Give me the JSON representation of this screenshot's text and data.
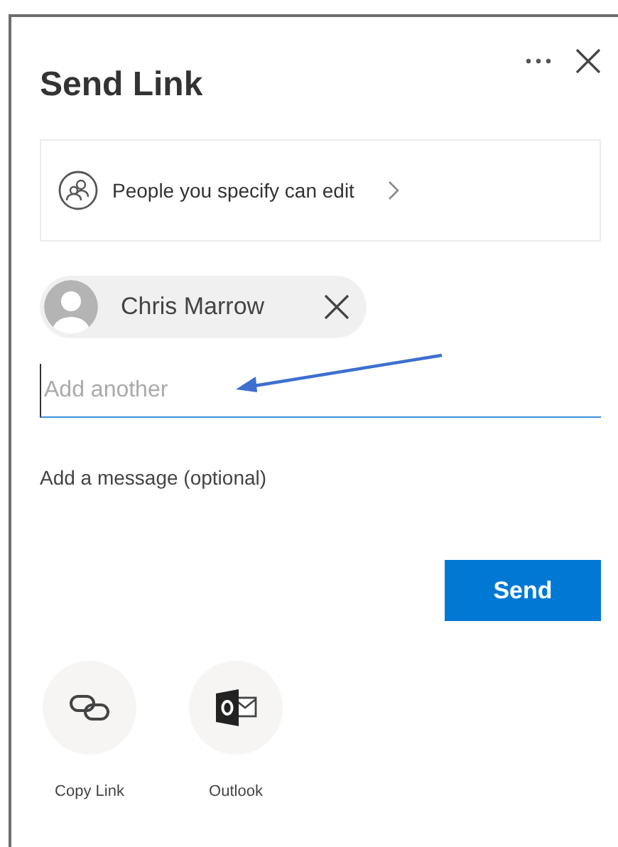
{
  "dialog": {
    "title": "Send Link"
  },
  "permission": {
    "label": "People you specify can edit"
  },
  "recipients": [
    {
      "name": "Chris Marrow"
    }
  ],
  "recipient_input": {
    "placeholder": "Add another",
    "focused": true
  },
  "message": {
    "placeholder": "Add a message (optional)"
  },
  "send_button": {
    "label": "Send"
  },
  "share_options": [
    {
      "kind": "copy-link",
      "label": "Copy Link"
    },
    {
      "kind": "outlook",
      "label": "Outlook"
    }
  ],
  "annotation": {
    "kind": "arrow"
  }
}
